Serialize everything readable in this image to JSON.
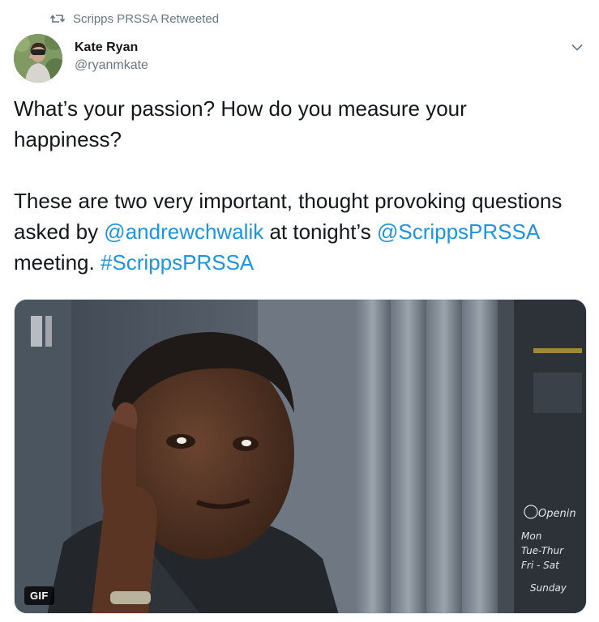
{
  "retweet": {
    "icon": "retweet-icon",
    "label": "Scripps PRSSA Retweeted"
  },
  "author": {
    "name": "Kate Ryan",
    "handle": "@ryanmkate"
  },
  "menu": {
    "icon": "chevron-down-icon"
  },
  "tweet": {
    "line1": "What’s your passion? How do you measure your happiness?",
    "p2_pre": "These are two very important, thought provoking questions asked by ",
    "mention1": "@andrewchwalik",
    "p2_mid": " at tonight’s ",
    "mention2": "@ScrippsPRSSA",
    "p2_post": " meeting. ",
    "hashtag": "#ScrippsPRSSA"
  },
  "media": {
    "badge": "GIF",
    "sign_lines": [
      "Openin",
      "Mon",
      "Tue-Thur",
      "Fri - Sat",
      "Sunday"
    ]
  },
  "colors": {
    "link": "#1b95e0",
    "secondary_text": "#657786",
    "primary_text": "#14171a"
  }
}
